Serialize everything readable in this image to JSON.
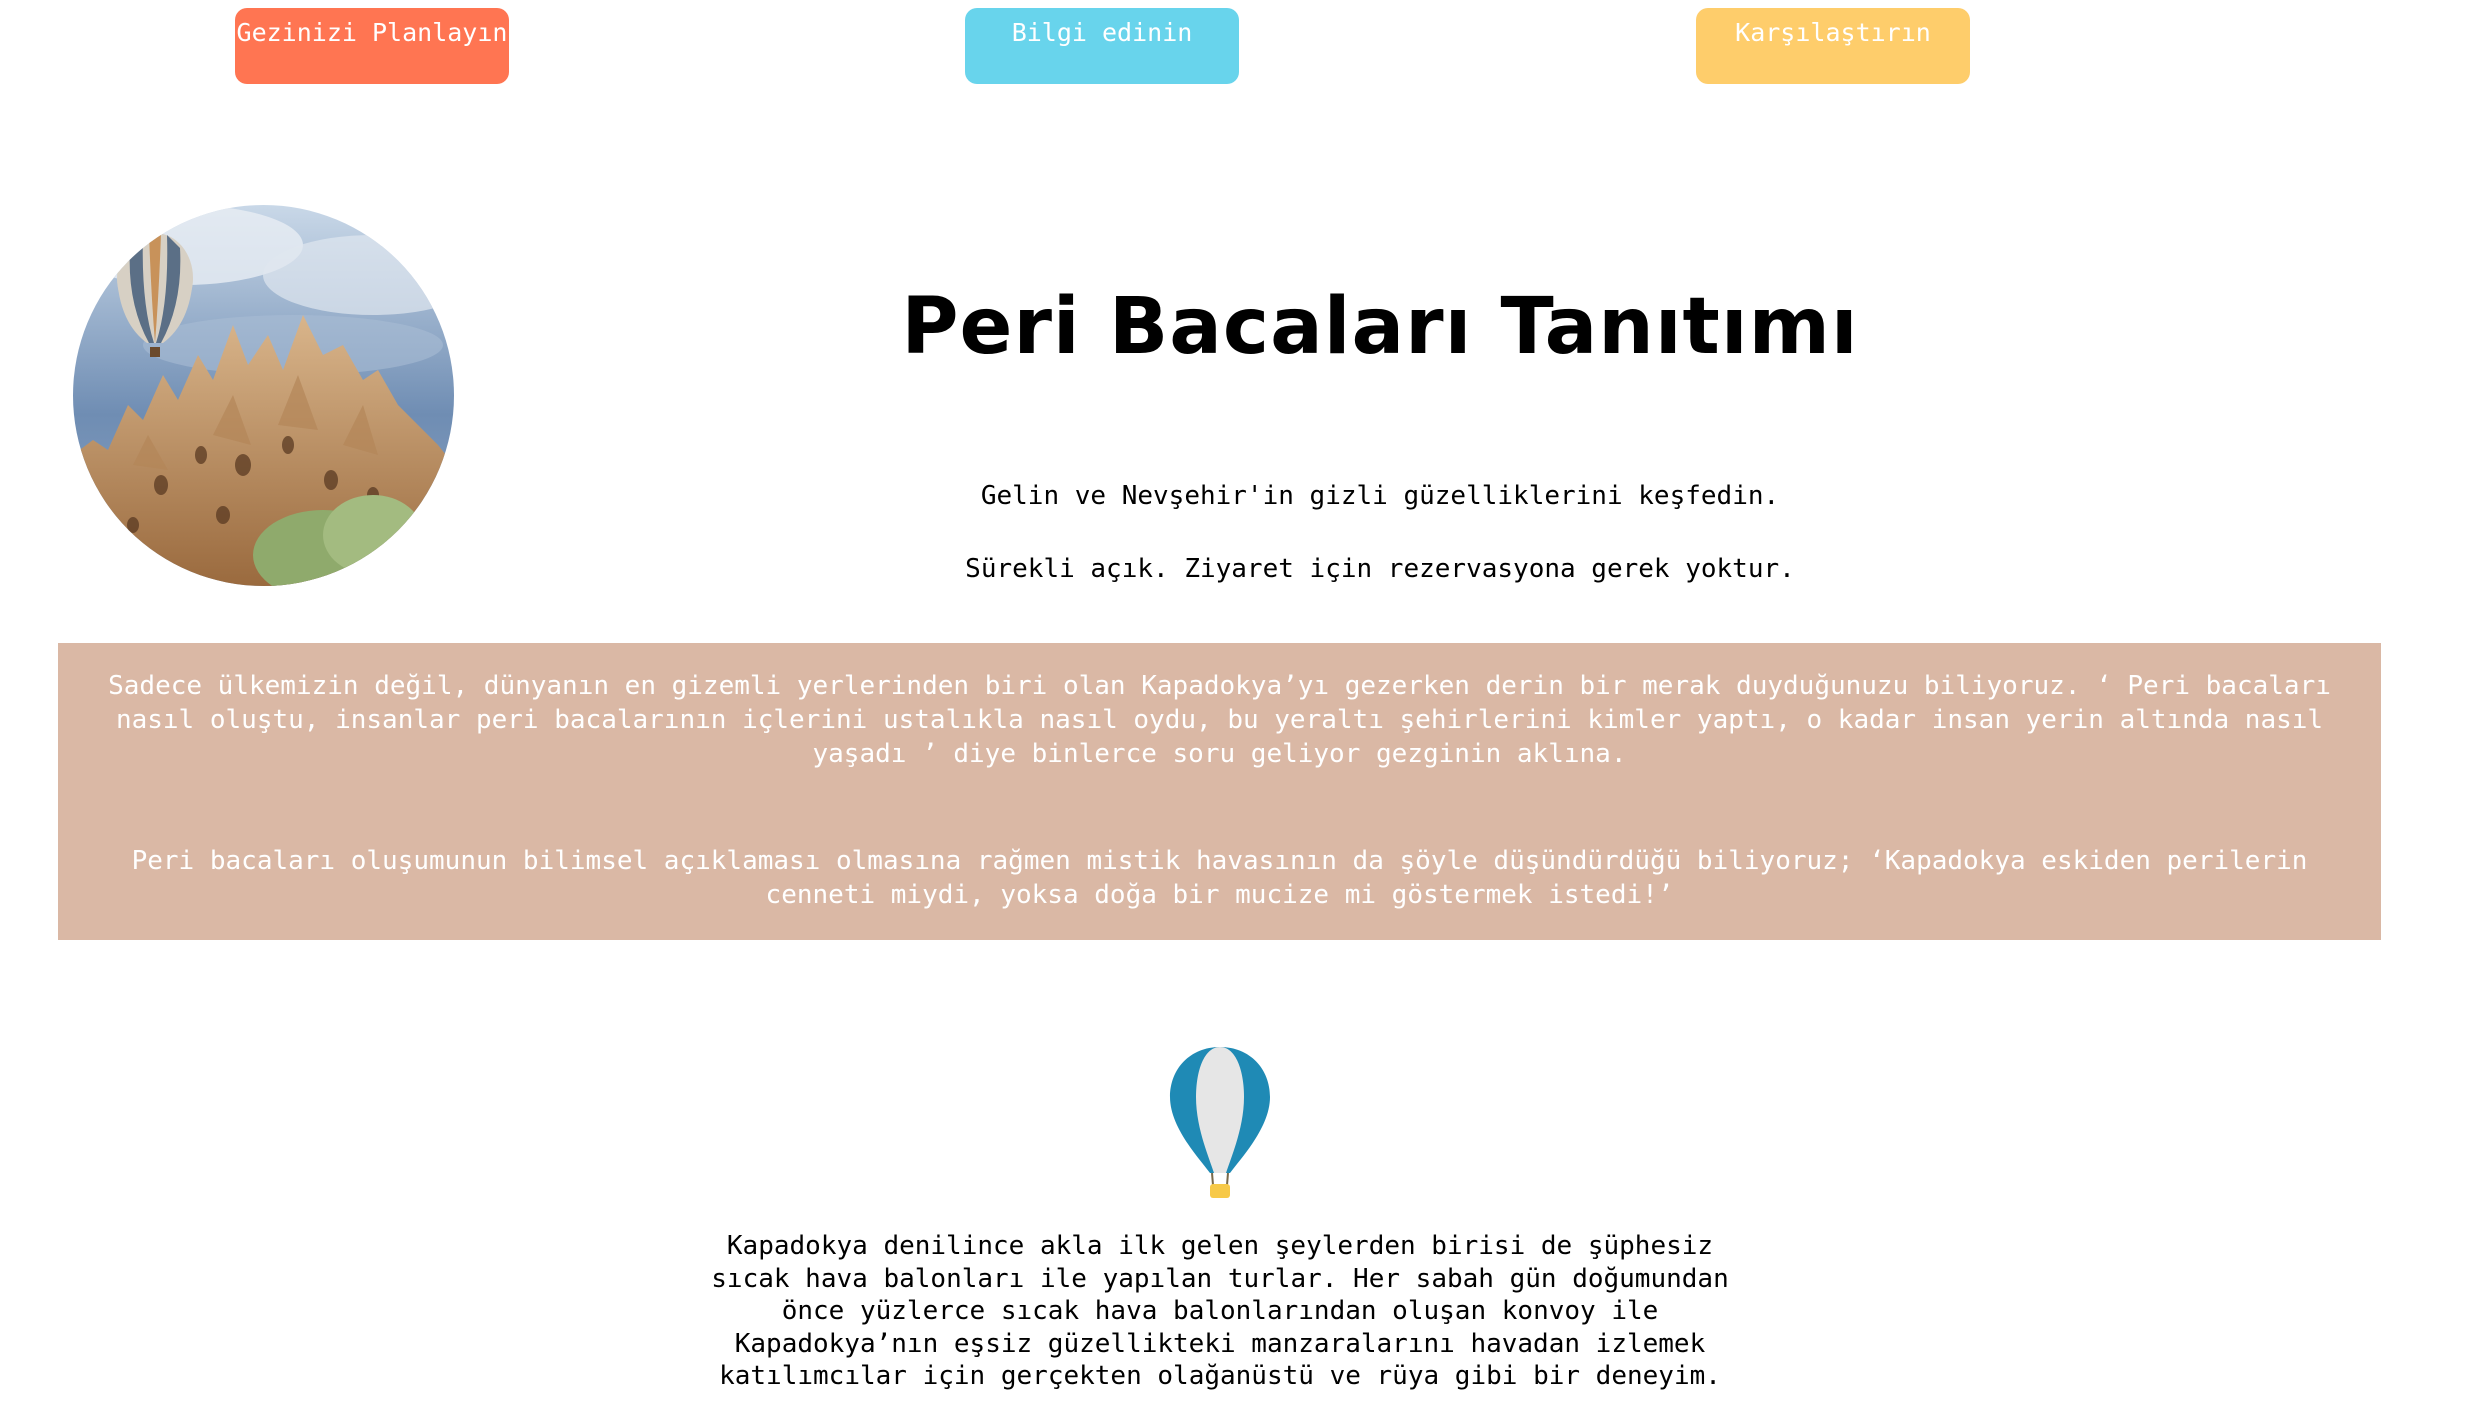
{
  "nav": {
    "plan_label": "Gezinizi Planlayın",
    "info_label": "Bilgi edinin",
    "compare_label": "Karşılaştırın"
  },
  "hero": {
    "title": "Peri Bacaları Tanıtımı",
    "subtitle_1": "Gelin ve Nevşehir'in gizli güzelliklerini keşfedin.",
    "subtitle_2": "Sürekli açık. Ziyaret için rezervasyona gerek yoktur."
  },
  "intro": {
    "paragraph_1": "Sadece ülkemizin değil, dünyanın en gizemli yerlerinden biri olan Kapadokya’yı gezerken derin bir merak duyduğunuzu biliyoruz. ‘ Peri bacaları nasıl oluştu, insanlar peri bacalarının içlerini ustalıkla nasıl oydu, bu yeraltı şehirlerini kimler yaptı, o kadar insan yerin altında nasıl yaşadı ’ diye binlerce soru geliyor gezginin aklına.",
    "paragraph_2": "Peri bacaları oluşumunun bilimsel açıklaması olmasına rağmen mistik havasının da şöyle düşündürdüğü biliyoruz; ‘Kapadokya eskiden perilerin cenneti miydi, yoksa doğa bir mucize mi göstermek istedi!’"
  },
  "balloon_section": {
    "icon": "hot-air-balloon-icon",
    "text": "Kapadokya denilince akla ilk gelen şeylerden birisi de şüphesiz sıcak hava balonları ile yapılan turlar. Her sabah gün doğumundan önce yüzlerce sıcak hava balonlarından oluşan konvoy ile Kapadokya’nın eşsiz güzellikteki manzaralarını havadan izlemek katılımcılar için gerçekten olağanüstü ve rüya gibi bir deneyim."
  },
  "colors": {
    "plan_button": "#ff7552",
    "info_button": "#68d4ec",
    "compare_button": "#fecd6b",
    "intro_background": "#dab8a5",
    "balloon_blue": "#1f8ab5",
    "balloon_basket": "#f7c948"
  }
}
